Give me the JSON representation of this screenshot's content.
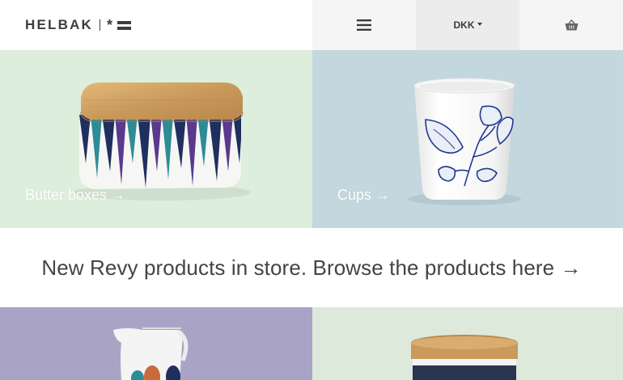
{
  "brand": {
    "name": "HELBAK",
    "star": "*"
  },
  "header": {
    "currency_label": "DKK",
    "menu_icon": "hamburger-menu-icon",
    "cart_icon": "basket-icon"
  },
  "categories": [
    {
      "label": "Butter boxes →",
      "background": "#deeedc"
    },
    {
      "label": "Cups →",
      "background": "#c3d7de"
    }
  ],
  "promo": {
    "text": "New Revy products in store. Browse the products here →"
  },
  "lower_tiles": [
    {
      "background": "#a9a4c6"
    },
    {
      "background": "#dde9da"
    }
  ],
  "colors": {
    "text": "#3a3a3a",
    "wood_lid": "#c89a5a",
    "pattern_navy": "#1f2f5e",
    "pattern_teal": "#2d8c96",
    "pattern_purple": "#5a3a8c",
    "cup_blue": "#1f3a8f"
  }
}
